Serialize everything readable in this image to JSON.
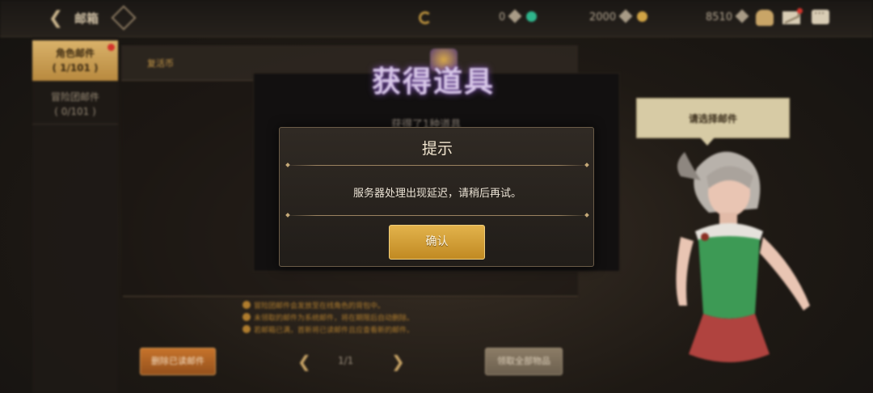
{
  "topbar": {
    "title": "邮箱",
    "currencies": [
      {
        "amount": "0"
      },
      {
        "amount": "2000"
      },
      {
        "amount": "8510"
      }
    ]
  },
  "tabs": [
    {
      "label": "角色邮件",
      "count": "( 1/101 )"
    },
    {
      "label": "冒险团邮件",
      "count": "( 0/101 )"
    }
  ],
  "mail_list": [
    {
      "title": "复活币"
    }
  ],
  "notes": [
    "冒险团邮件会发放至在线角色的背包中。",
    "未领取的邮件为系统邮件，将在期限后自动删除。",
    "若邮箱已满，首新将已读邮件且应查看新的邮件。"
  ],
  "footer": {
    "delete_label": "删除已读邮件",
    "page": "1/1",
    "collect_label": "领取全部物品"
  },
  "reward_window": {
    "title": "获得道具",
    "subtitle": "获得了1种道具"
  },
  "npc": {
    "bubble_text": "请选择邮件"
  },
  "dialog": {
    "title": "提示",
    "message": "服务器处理出现延迟，请稍后再试。",
    "confirm_label": "确认"
  },
  "colors": {
    "accent_gold": "#c18a22",
    "notification_red": "#d3332b"
  }
}
